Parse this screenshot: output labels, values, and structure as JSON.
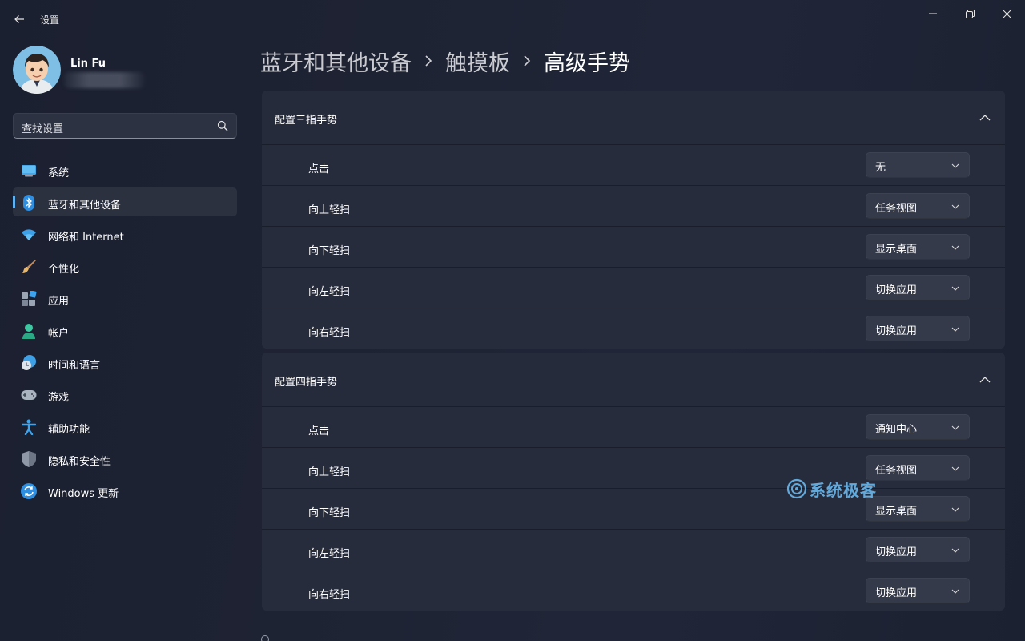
{
  "window": {
    "title": "设置"
  },
  "profile": {
    "name": "Lin Fu"
  },
  "search": {
    "placeholder": "查找设置"
  },
  "sidebar": {
    "items": [
      {
        "label": "系统",
        "icon": "system-icon",
        "active": false
      },
      {
        "label": "蓝牙和其他设备",
        "icon": "bluetooth-icon",
        "active": true
      },
      {
        "label": "网络和 Internet",
        "icon": "wifi-icon",
        "active": false
      },
      {
        "label": "个性化",
        "icon": "brush-icon",
        "active": false
      },
      {
        "label": "应用",
        "icon": "apps-icon",
        "active": false
      },
      {
        "label": "帐户",
        "icon": "account-icon",
        "active": false
      },
      {
        "label": "时间和语言",
        "icon": "time-language-icon",
        "active": false
      },
      {
        "label": "游戏",
        "icon": "gamepad-icon",
        "active": false
      },
      {
        "label": "辅助功能",
        "icon": "accessibility-icon",
        "active": false
      },
      {
        "label": "隐私和安全性",
        "icon": "shield-icon",
        "active": false
      },
      {
        "label": "Windows 更新",
        "icon": "update-icon",
        "active": false
      }
    ]
  },
  "breadcrumb": {
    "items": [
      "蓝牙和其他设备",
      "触摸板",
      "高级手势"
    ]
  },
  "three_finger": {
    "title": "配置三指手势",
    "rows": [
      {
        "label": "点击",
        "value": "无"
      },
      {
        "label": "向上轻扫",
        "value": "任务视图"
      },
      {
        "label": "向下轻扫",
        "value": "显示桌面"
      },
      {
        "label": "向左轻扫",
        "value": "切换应用"
      },
      {
        "label": "向右轻扫",
        "value": "切换应用"
      }
    ]
  },
  "four_finger": {
    "title": "配置四指手势",
    "rows": [
      {
        "label": "点击",
        "value": "通知中心"
      },
      {
        "label": "向上轻扫",
        "value": "任务视图"
      },
      {
        "label": "向下轻扫",
        "value": "显示桌面"
      },
      {
        "label": "向左轻扫",
        "value": "切换应用"
      },
      {
        "label": "向右轻扫",
        "value": "切换应用"
      }
    ]
  },
  "watermark": {
    "text": "系统极客"
  },
  "colors": {
    "accent": "#5fb2f2",
    "background": "#1e2333",
    "card": "#262b3b"
  }
}
